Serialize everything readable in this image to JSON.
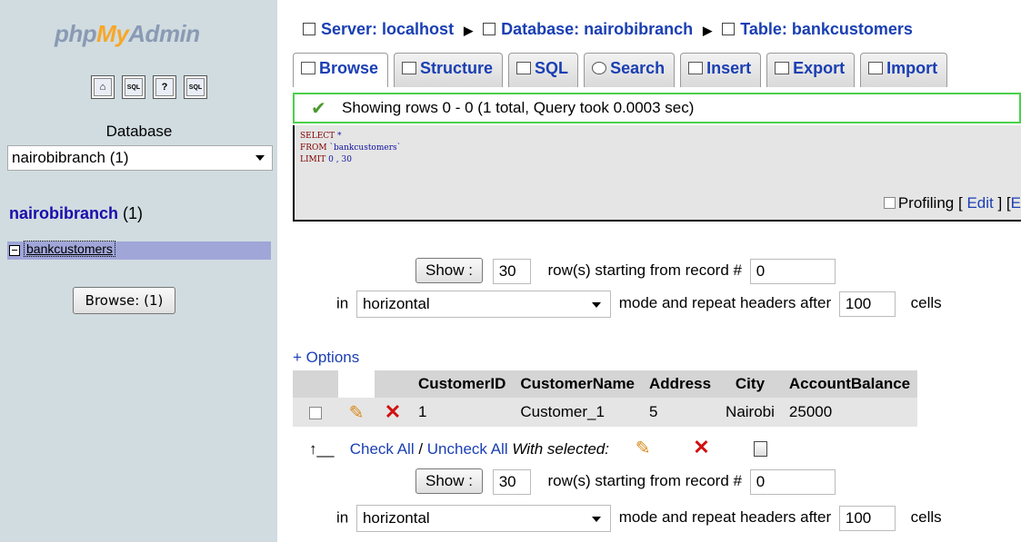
{
  "sidebar": {
    "logo": {
      "php": "php",
      "my": "My",
      "admin": "Admin"
    },
    "icons": [
      "home-icon",
      "sql-icon",
      "help-icon",
      "query-window-icon"
    ],
    "icon_glyphs": [
      "⌂",
      "SQL",
      "?",
      "SQL"
    ],
    "database_label": "Database",
    "database_selected": "nairobibranch (1)",
    "db_link": {
      "name": "nairobibranch",
      "count": "(1)"
    },
    "table_item": "bankcustomers",
    "browse_button": "Browse:  (1)"
  },
  "breadcrumb": {
    "server": "Server: localhost",
    "database": "Database: nairobibranch",
    "table": "Table: bankcustomers"
  },
  "tabs": [
    {
      "label": "Browse",
      "icon": "browse-icon",
      "active": true
    },
    {
      "label": "Structure",
      "icon": "structure-icon"
    },
    {
      "label": "SQL",
      "icon": "sql-icon"
    },
    {
      "label": "Search",
      "icon": "search-icon"
    },
    {
      "label": "Insert",
      "icon": "insert-icon"
    },
    {
      "label": "Export",
      "icon": "export-icon"
    },
    {
      "label": "Import",
      "icon": "import-icon"
    }
  ],
  "success_message": "Showing rows 0 - 0 (1 total, Query took 0.0003 sec)",
  "sql": {
    "line1_kw": "SELECT",
    "line1_rest": " *",
    "line2_kw": "FROM",
    "line2_rest": " `bankcustomers`",
    "line3_kw": "LIMIT",
    "line3_rest": " 0 , 30"
  },
  "profiling": {
    "label": "Profiling",
    "open": "[",
    "edit": "Edit",
    "close": "] [",
    "extra": "E"
  },
  "nav_top": {
    "show_label": "Show :",
    "rows_value": "30",
    "starting_text": "row(s) starting from record #",
    "start_value": "0",
    "in_text": "in",
    "mode_value": "horizontal",
    "mode_text": "mode and repeat headers after",
    "repeat_value": "100",
    "cells_text": "cells"
  },
  "options_link": "+ Options",
  "table": {
    "columns": [
      "CustomerID",
      "CustomerName",
      "Address",
      "City",
      "AccountBalance"
    ],
    "rows": [
      [
        "1",
        "Customer_1",
        "5",
        "Nairobi",
        "25000"
      ]
    ]
  },
  "with_selected": {
    "check_all": "Check All",
    "slash": " / ",
    "uncheck_all": "Uncheck All",
    "label": "With selected:"
  },
  "nav_bottom": {
    "show_label": "Show :",
    "rows_value": "30",
    "starting_text": "row(s) starting from record #",
    "start_value": "0",
    "in_text": "in",
    "mode_value": "horizontal",
    "mode_text": "mode and repeat headers after",
    "repeat_value": "100",
    "cells_text": "cells"
  }
}
